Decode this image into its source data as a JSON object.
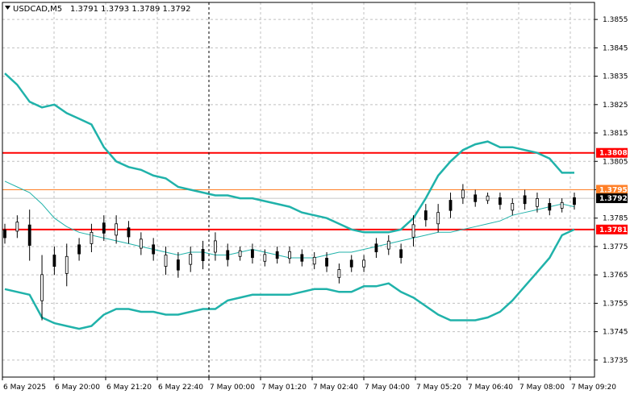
{
  "header": {
    "symbol_timeframe": "USDCAD,M5",
    "ohlc": "1.3791 1.3793 1.3789 1.3792"
  },
  "colors": {
    "background": "#ffffff",
    "grid": "#c0c0c0",
    "candle": "#000000",
    "bollinger": "#20b2aa",
    "level_line": "#ff0000",
    "level_badge": "#ff0000",
    "price_line_orange": "#ff7f27",
    "current_price_badge": "#000000"
  },
  "chart_data": {
    "type": "candlestick",
    "symbol": "USDCAD",
    "timeframe": "M5",
    "ylim": [
      1.3729,
      1.3861
    ],
    "y_ticks": [
      "1.3855",
      "1.3845",
      "1.3835",
      "1.3825",
      "1.3815",
      "1.3805",
      "1.3795",
      "1.3785",
      "1.3775",
      "1.3765",
      "1.3755",
      "1.3745",
      "1.3735"
    ],
    "x_ticks": [
      "6 May 2025",
      "6 May 20:00",
      "6 May 21:20",
      "6 May 22:40",
      "7 May 00:00",
      "7 May 01:20",
      "7 May 02:40",
      "7 May 04:00",
      "7 May 05:20",
      "7 May 06:40",
      "7 May 08:00",
      "7 May 09:20"
    ],
    "day_separator_label": "7 May 00:00",
    "horizontal_levels": [
      {
        "value": 1.3808,
        "label": "1.3808",
        "color": "#ff0000"
      },
      {
        "value": 1.3781,
        "label": "1.3781",
        "color": "#ff0000"
      }
    ],
    "price_lines": [
      {
        "value": 1.3795,
        "label": "1.3795",
        "color": "#ff7f27"
      },
      {
        "value": 1.3792,
        "label": "1.3792",
        "color": "#000000"
      }
    ],
    "bollinger_upper": [
      1.3836,
      1.3832,
      1.3826,
      1.3824,
      1.3825,
      1.3822,
      1.382,
      1.3818,
      1.381,
      1.3805,
      1.3803,
      1.3802,
      1.38,
      1.3799,
      1.3796,
      1.3795,
      1.3794,
      1.3793,
      1.3793,
      1.3792,
      1.3792,
      1.3791,
      1.379,
      1.3789,
      1.3787,
      1.3786,
      1.3785,
      1.3783,
      1.3781,
      1.378,
      1.378,
      1.378,
      1.3781,
      1.3785,
      1.3792,
      1.38,
      1.3805,
      1.3809,
      1.3811,
      1.3812,
      1.381,
      1.381,
      1.3809,
      1.3808,
      1.3806,
      1.3801,
      1.3801
    ],
    "bollinger_middle": [
      1.3798,
      1.3796,
      1.3794,
      1.379,
      1.3785,
      1.3782,
      1.378,
      1.3779,
      1.3778,
      1.3777,
      1.3776,
      1.3775,
      1.3774,
      1.3773,
      1.3772,
      1.3773,
      1.3773,
      1.3772,
      1.3772,
      1.3773,
      1.3774,
      1.3773,
      1.3772,
      1.3771,
      1.3771,
      1.3771,
      1.3772,
      1.3773,
      1.3773,
      1.3774,
      1.3775,
      1.3776,
      1.3777,
      1.3778,
      1.3779,
      1.378,
      1.378,
      1.3781,
      1.3782,
      1.3783,
      1.3784,
      1.3786,
      1.3787,
      1.3788,
      1.3789,
      1.379,
      1.3789
    ],
    "bollinger_lower": [
      1.376,
      1.3759,
      1.3758,
      1.375,
      1.3748,
      1.3747,
      1.3746,
      1.3747,
      1.3751,
      1.3753,
      1.3753,
      1.3752,
      1.3752,
      1.3751,
      1.3751,
      1.3752,
      1.3753,
      1.3753,
      1.3756,
      1.3757,
      1.3758,
      1.3758,
      1.3758,
      1.3758,
      1.3759,
      1.376,
      1.376,
      1.3759,
      1.3759,
      1.3761,
      1.3761,
      1.3762,
      1.3759,
      1.3757,
      1.3754,
      1.3751,
      1.3749,
      1.3749,
      1.3749,
      1.375,
      1.3752,
      1.3756,
      1.3761,
      1.3766,
      1.3771,
      1.3779,
      1.3781
    ],
    "candles_hl": [
      [
        1.3783,
        1.3776
      ],
      [
        1.3786,
        1.3778
      ],
      [
        1.3788,
        1.377
      ],
      [
        1.3772,
        1.3749
      ],
      [
        1.3775,
        1.3765
      ],
      [
        1.3776,
        1.3761
      ],
      [
        1.3778,
        1.377
      ],
      [
        1.3783,
        1.3773
      ],
      [
        1.3786,
        1.3777
      ],
      [
        1.3786,
        1.3776
      ],
      [
        1.3784,
        1.3776
      ],
      [
        1.378,
        1.3772
      ],
      [
        1.3778,
        1.377
      ],
      [
        1.3775,
        1.3765
      ],
      [
        1.3773,
        1.3764
      ],
      [
        1.3775,
        1.3766
      ],
      [
        1.3777,
        1.3767
      ],
      [
        1.378,
        1.377
      ],
      [
        1.3776,
        1.3768
      ],
      [
        1.3775,
        1.377
      ],
      [
        1.3776,
        1.3769
      ],
      [
        1.3774,
        1.3768
      ],
      [
        1.3775,
        1.3769
      ],
      [
        1.3775,
        1.3769
      ],
      [
        1.3774,
        1.3768
      ],
      [
        1.3773,
        1.3767
      ],
      [
        1.3773,
        1.3766
      ],
      [
        1.3769,
        1.3762
      ],
      [
        1.3772,
        1.3766
      ],
      [
        1.3772,
        1.3766
      ],
      [
        1.3778,
        1.3771
      ],
      [
        1.3779,
        1.3772
      ],
      [
        1.3776,
        1.3769
      ],
      [
        1.3786,
        1.3775
      ],
      [
        1.379,
        1.3782
      ],
      [
        1.379,
        1.378
      ],
      [
        1.3794,
        1.3785
      ],
      [
        1.3797,
        1.379
      ],
      [
        1.3795,
        1.3789
      ],
      [
        1.3794,
        1.379
      ],
      [
        1.3794,
        1.3788
      ],
      [
        1.3792,
        1.3786
      ],
      [
        1.3795,
        1.3788
      ],
      [
        1.3794,
        1.3787
      ],
      [
        1.3792,
        1.3786
      ],
      [
        1.3792,
        1.3787
      ],
      [
        1.3794,
        1.3788
      ]
    ]
  }
}
